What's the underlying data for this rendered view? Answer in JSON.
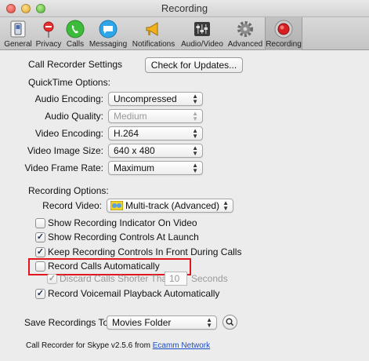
{
  "window": {
    "title": "Recording"
  },
  "toolbar": {
    "items": [
      {
        "label": "General",
        "icon": "general-switch-icon"
      },
      {
        "label": "Privacy",
        "icon": "privacy-sign-icon"
      },
      {
        "label": "Calls",
        "icon": "phone-icon"
      },
      {
        "label": "Messaging",
        "icon": "chat-bubble-icon"
      },
      {
        "label": "Notifications",
        "icon": "megaphone-icon"
      },
      {
        "label": "Audio/Video",
        "icon": "mixer-sliders-icon"
      },
      {
        "label": "Advanced",
        "icon": "gear-icon"
      },
      {
        "label": "Recording",
        "icon": "record-button-icon",
        "selected": true
      }
    ]
  },
  "settings": {
    "call_recorder_label": "Call Recorder Settings",
    "check_updates_label": "Check for Updates...",
    "quicktime_heading": "QuickTime Options:",
    "audio_encoding": {
      "label": "Audio Encoding:",
      "value": "Uncompressed"
    },
    "audio_quality": {
      "label": "Audio Quality:",
      "value": "Medium",
      "disabled": true
    },
    "video_encoding": {
      "label": "Video Encoding:",
      "value": "H.264"
    },
    "video_image_size": {
      "label": "Video Image Size:",
      "value": "640 x 480"
    },
    "video_frame_rate": {
      "label": "Video Frame Rate:",
      "value": "Maximum"
    },
    "recording_heading": "Recording Options:",
    "record_video": {
      "label": "Record Video:",
      "value": "Multi-track (Advanced)"
    },
    "checkboxes": [
      {
        "label": "Show Recording Indicator On Video",
        "checked": false
      },
      {
        "label": "Show Recording Controls At Launch",
        "checked": true
      },
      {
        "label": "Keep Recording Controls In Front During Calls",
        "checked": true
      },
      {
        "label": "Record Calls Automatically",
        "checked": false,
        "highlighted": true
      },
      {
        "label": "Discard Calls Shorter Than",
        "checked": true,
        "disabled": true
      },
      {
        "label": "Record Voicemail Playback Automatically",
        "checked": true
      }
    ],
    "discard_seconds_value": "10",
    "seconds_label": "Seconds",
    "save_recordings": {
      "label": "Save Recordings To:",
      "value": "Movies Folder"
    },
    "footer_text": "Call Recorder for Skype v2.5.6 from",
    "footer_link": "Ecamm Network"
  },
  "colors": {
    "highlight": "#e2161e",
    "link": "#1a4dc8",
    "checkmark": "#1b2a4a"
  }
}
